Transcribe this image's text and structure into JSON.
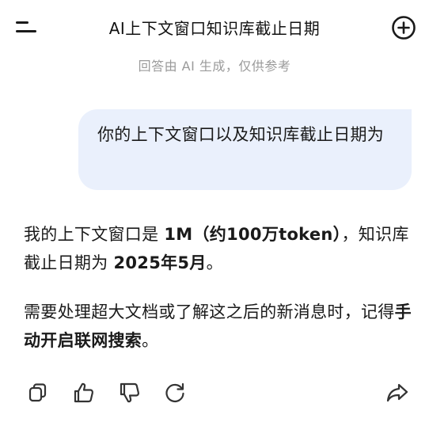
{
  "header": {
    "title": "AI上下文窗口知识库截止日期",
    "menu_icon": "menu-icon",
    "new_chat_icon": "plus-circle-icon"
  },
  "disclaimer": "回答由 AI 生成，仅供参考",
  "user_message": {
    "text": "你的上下文窗口以及知识库截止日期为"
  },
  "assistant_message": {
    "p1_part1": "我的上下文窗口是 ",
    "p1_bold1": "1M（约100万token）",
    "p1_part2": "，知识库截止日期为 ",
    "p1_bold2": "2025年5月",
    "p1_part3": "。",
    "p2_part1": "需要处理超大文档或了解这之后的新消息时，记得",
    "p2_bold": "手动开启联网搜索",
    "p2_part2": "。"
  },
  "actions": [
    {
      "icon": "copy-icon"
    },
    {
      "icon": "thumbs-up-icon"
    },
    {
      "icon": "thumbs-down-icon"
    },
    {
      "icon": "regenerate-icon"
    },
    {
      "icon": "share-icon"
    }
  ],
  "colors": {
    "bubble_bg": "#eaf0fc",
    "text": "#1a1a1a",
    "muted": "#9a9a9a",
    "icon": "#333333"
  }
}
